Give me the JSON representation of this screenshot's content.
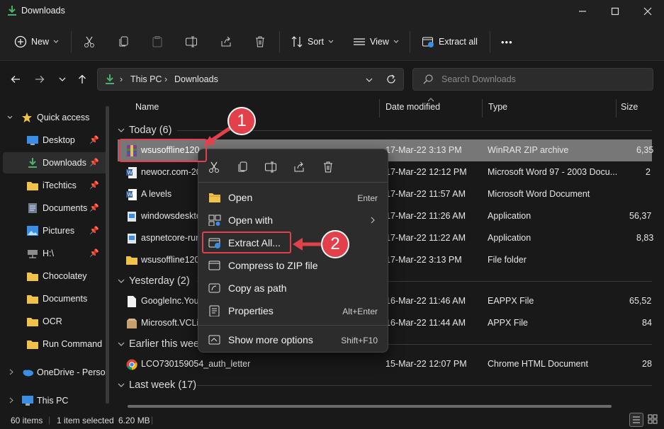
{
  "window": {
    "title": "Downloads"
  },
  "toolbar": {
    "new_label": "New",
    "sort_label": "Sort",
    "view_label": "View",
    "extract_all_label": "Extract all",
    "more_label": "•••"
  },
  "address": {
    "this_pc": "This PC",
    "downloads": "Downloads"
  },
  "search": {
    "placeholder": "Search Downloads"
  },
  "sidebar": {
    "quick_access": "Quick access",
    "items": [
      {
        "label": "Desktop",
        "pinned": true
      },
      {
        "label": "Downloads",
        "pinned": true,
        "selected": true
      },
      {
        "label": "iTechtics",
        "pinned": true
      },
      {
        "label": "Documents",
        "pinned": true
      },
      {
        "label": "Pictures",
        "pinned": true
      },
      {
        "label": "H:\\",
        "pinned": true
      },
      {
        "label": "Chocolatey",
        "pinned": false
      },
      {
        "label": "Documents",
        "pinned": false
      },
      {
        "label": "OCR",
        "pinned": false
      },
      {
        "label": "Run Command",
        "pinned": false
      }
    ],
    "onedrive": "OneDrive - Perso",
    "this_pc": "This PC"
  },
  "columns": {
    "name": "Name",
    "date": "Date modified",
    "type": "Type",
    "size": "Size"
  },
  "groups": {
    "today": "Today (6)",
    "yesterday": "Yesterday (2)",
    "earlier": "Earlier this week",
    "last_week": "Last week (17)"
  },
  "files": {
    "r1": {
      "name": "wsusoffline120",
      "date": "17-Mar-22 3:13 PM",
      "type": "WinRAR ZIP archive",
      "size": "6,35"
    },
    "r2": {
      "name": "newocr.com-20",
      "date": "17-Mar-22 12:12 PM",
      "type": "Microsoft Word 97 - 2003 Docu...",
      "size": "2"
    },
    "r3": {
      "name": "A levels",
      "date": "17-Mar-22 11:57 AM",
      "type": "Microsoft Word Document",
      "size": ""
    },
    "r4": {
      "name": "windowsdeskto",
      "date": "17-Mar-22 11:26 AM",
      "type": "Application",
      "size": "56,37"
    },
    "r5": {
      "name": "aspnetcore-run",
      "date": "17-Mar-22 11:22 AM",
      "type": "Application",
      "size": "8,83"
    },
    "r6": {
      "name": "wsusoffline120",
      "date": "17-Mar-22 3:13 PM",
      "type": "File folder",
      "size": ""
    },
    "r7": {
      "name": "GoogleInc.YouT",
      "date": "16-Mar-22 11:46 AM",
      "type": "EAPPX File",
      "size": "65,52"
    },
    "r8": {
      "name": "Microsoft.VCLi",
      "date": "16-Mar-22 11:44 AM",
      "type": "APPX File",
      "size": "84"
    },
    "r9": {
      "name": "LCO730159054_auth_letter",
      "date": "15-Mar-22 12:07 PM",
      "type": "Chrome HTML Document",
      "size": "28"
    }
  },
  "context_menu": {
    "open": "Open",
    "open_key": "Enter",
    "open_with": "Open with",
    "extract_all": "Extract All...",
    "compress": "Compress to ZIP file",
    "copy_path": "Copy as path",
    "properties": "Properties",
    "properties_key": "Alt+Enter",
    "more_options": "Show more options",
    "more_options_key": "Shift+F10"
  },
  "callouts": {
    "one": "1",
    "two": "2"
  },
  "status": {
    "items": "60 items",
    "selected": "1 item selected",
    "size": "6.20 MB"
  },
  "colors": {
    "accent": "#e2414b",
    "folder": "#f0c24a",
    "download_green": "#4caf6a"
  }
}
